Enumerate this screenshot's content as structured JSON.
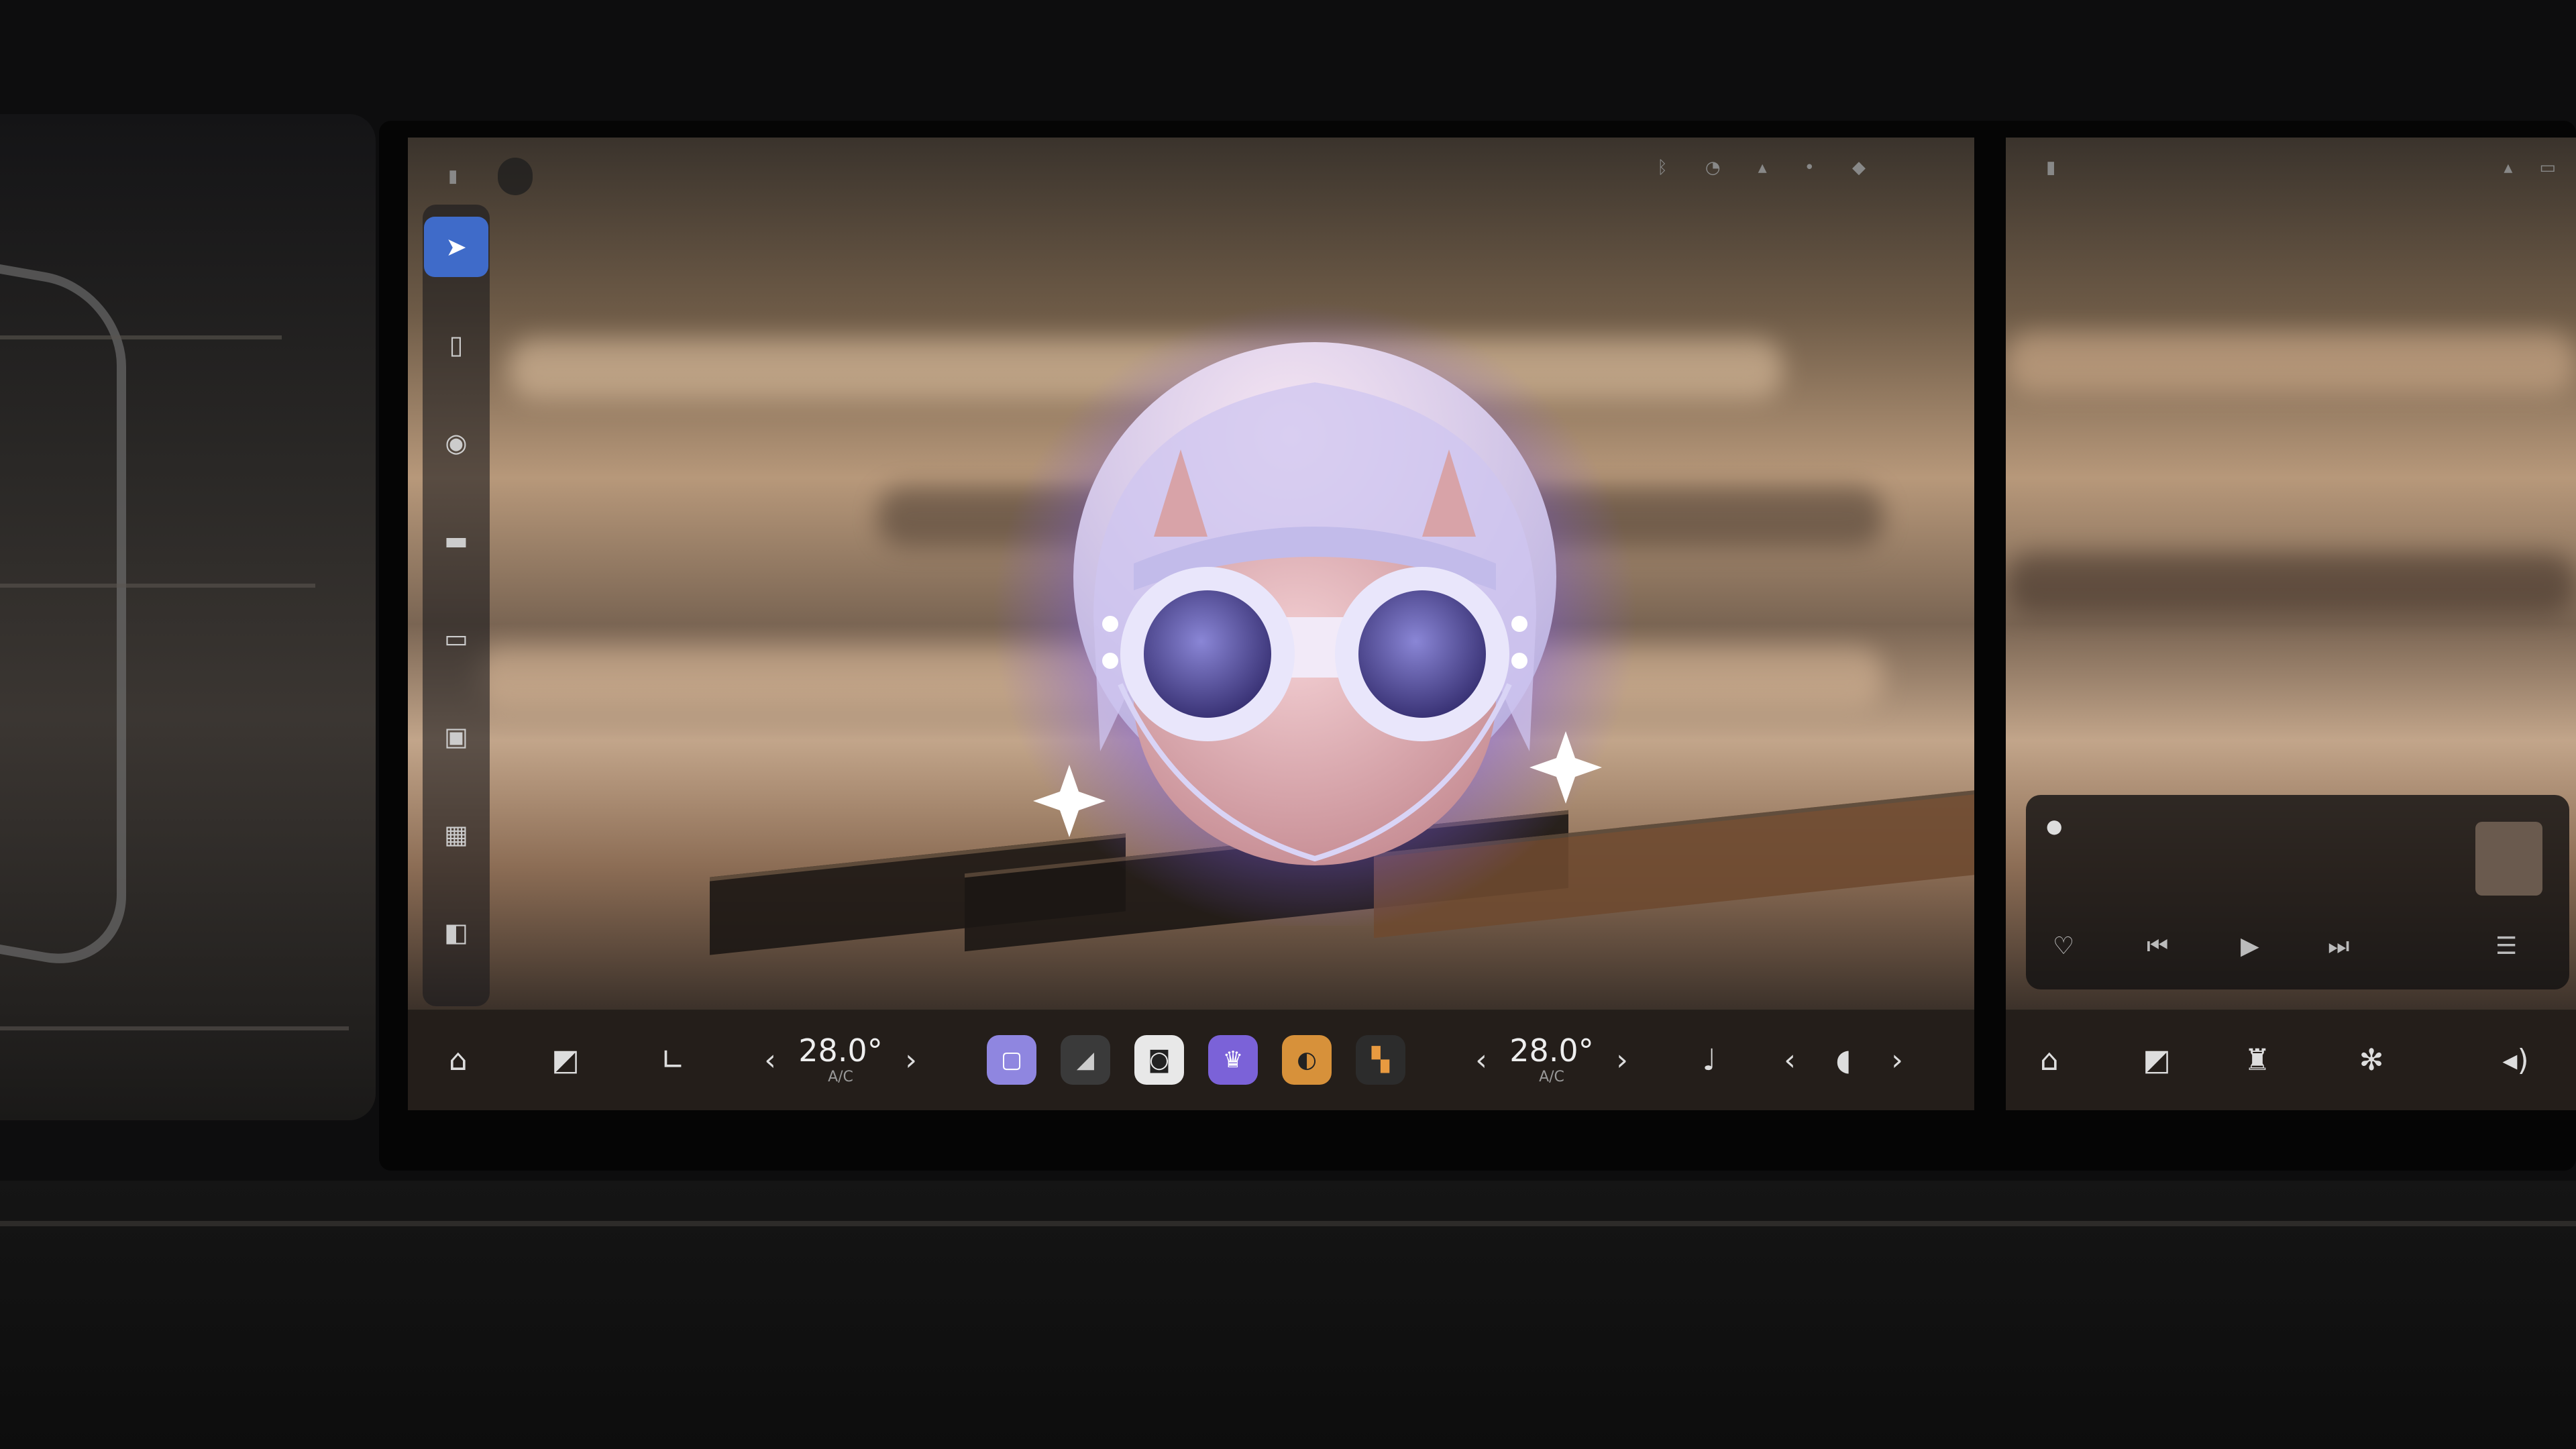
{
  "status_bar": {
    "pill_text": "",
    "left_icon": "lock-icon",
    "icons": [
      "bluetooth-icon",
      "wifi-icon",
      "signal-icon",
      "battery-icon"
    ],
    "time_left": "",
    "time_right": ""
  },
  "side_rail": {
    "items": [
      {
        "icon": "navigation-icon",
        "active": true
      },
      {
        "icon": "phone-icon",
        "active": false
      },
      {
        "icon": "assistant-icon",
        "active": false
      },
      {
        "icon": "media-icon",
        "active": false
      },
      {
        "icon": "car-icon",
        "active": false
      },
      {
        "icon": "camera-icon",
        "active": false
      },
      {
        "icon": "settings-icon",
        "active": false
      },
      {
        "icon": "apps-icon",
        "active": false
      }
    ]
  },
  "dock": {
    "driver_temp": "28.0°",
    "driver_temp_sub": "A/C",
    "passenger_temp": "28.0°",
    "passenger_temp_sub": "A/C",
    "apps": [
      {
        "icon": "notes-app-icon",
        "color": "#8f86e0"
      },
      {
        "icon": "gallery-app-icon",
        "color": "#3a3a3a"
      },
      {
        "icon": "camera-app-icon",
        "color": "#e8e8e8"
      },
      {
        "icon": "crown-app-icon",
        "color": "#7b62d8"
      },
      {
        "icon": "orange-app-icon",
        "color": "#d7913a"
      },
      {
        "icon": "grid-app-icon",
        "color": "#2c2c2c"
      }
    ]
  },
  "media": {
    "source": "",
    "title": "",
    "artist": ""
  },
  "colors": {
    "accent": "#3f6bc9",
    "avatar_glow": "#7d5df0",
    "avatar_skin": "#d8a3a8",
    "avatar_hair": "#b8b2e6"
  }
}
